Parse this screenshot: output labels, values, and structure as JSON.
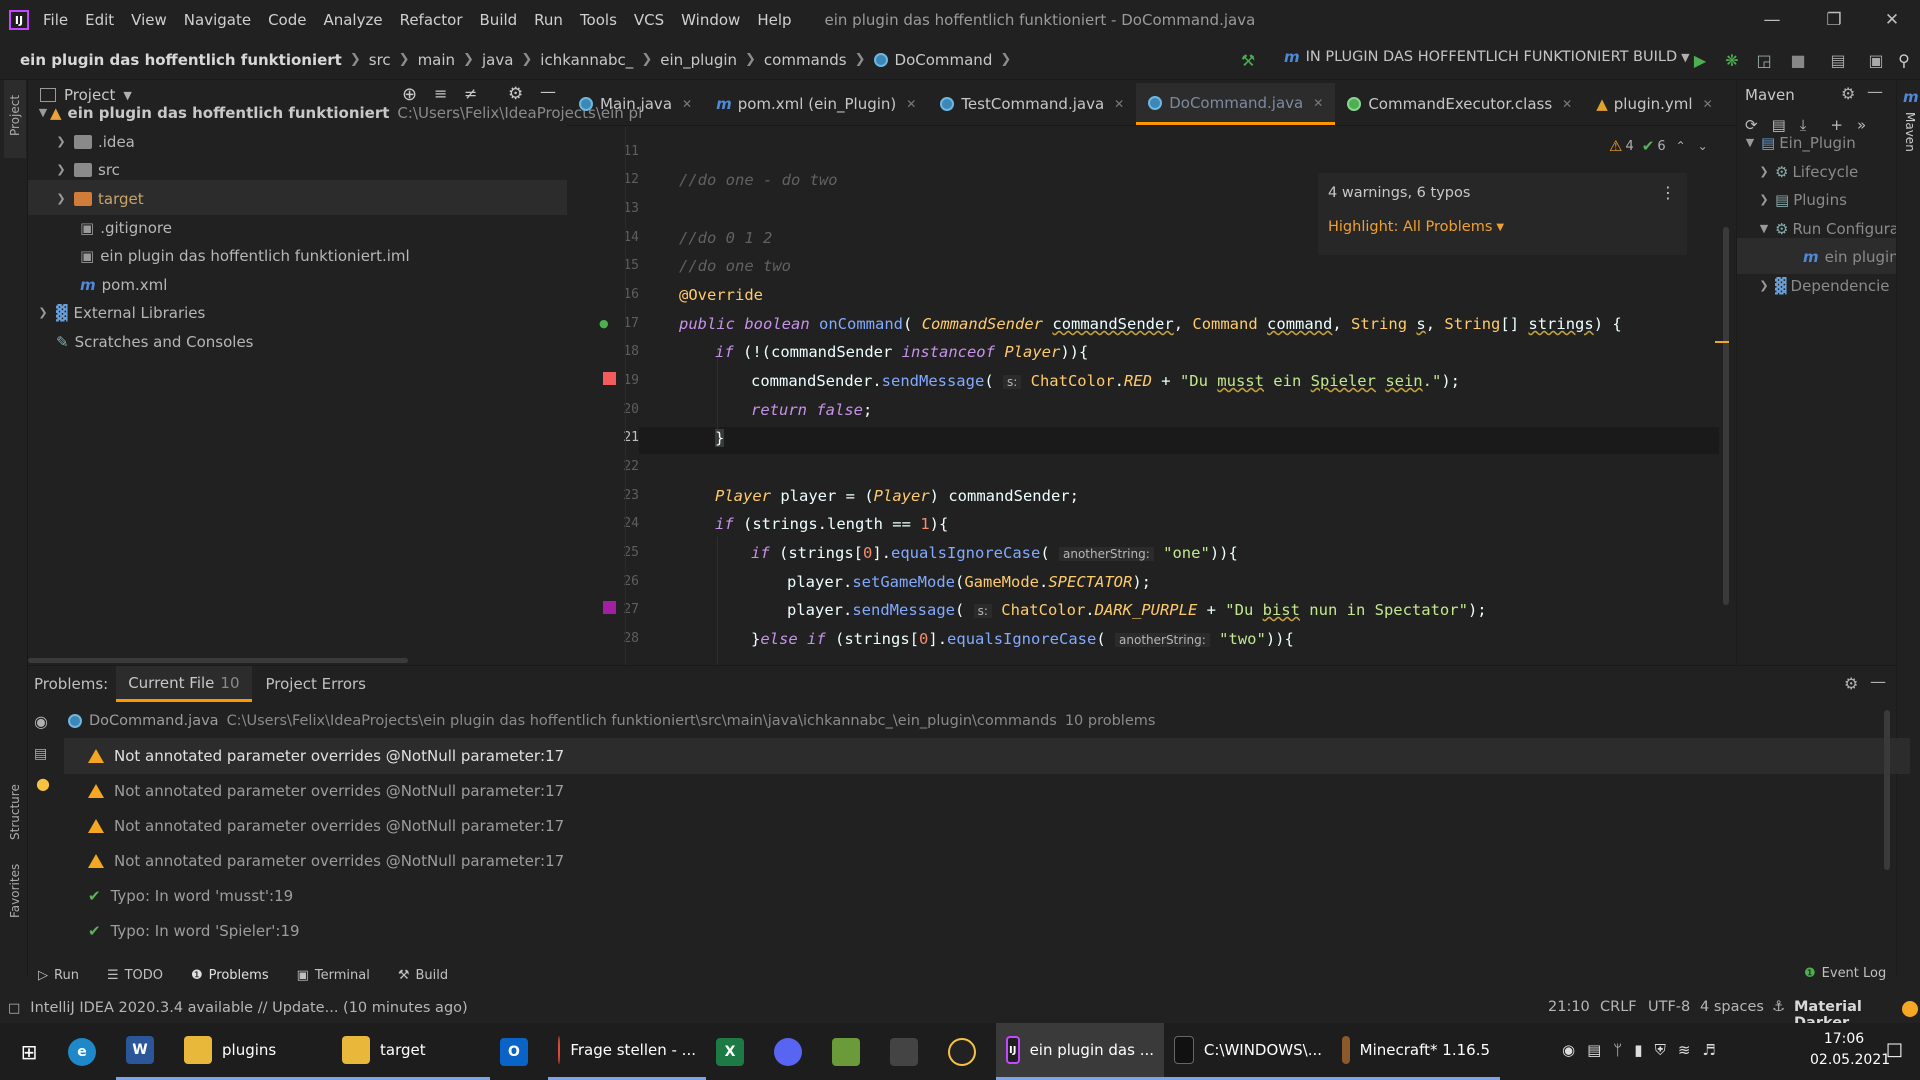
{
  "menubar": {
    "items": [
      "File",
      "Edit",
      "View",
      "Navigate",
      "Code",
      "Analyze",
      "Refactor",
      "Build",
      "Run",
      "Tools",
      "VCS",
      "Window",
      "Help"
    ],
    "window_title": "ein plugin das hoffentlich funktioniert - DoCommand.java"
  },
  "breadcrumbs": [
    "ein plugin das hoffentlich funktioniert",
    "src",
    "main",
    "java",
    "ichkannabc_",
    "ein_plugin",
    "commands",
    "DoCommand"
  ],
  "run_config": "IN PLUGIN DAS HOFFENTLICH FUNKTIONIERT BUILD",
  "project": {
    "title": "Project",
    "root": "ein plugin das hoffentlich funktioniert",
    "root_path": "C:\\Users\\Felix\\IdeaProjects\\ein pl",
    "items": [
      ".idea",
      "src",
      "target",
      ".gitignore",
      "ein plugin das hoffentlich funktioniert.iml",
      "pom.xml",
      "External Libraries",
      "Scratches and Consoles"
    ]
  },
  "tabs": [
    "Main.java",
    "pom.xml (ein_Plugin)",
    "TestCommand.java",
    "DoCommand.java",
    "CommandExecutor.class",
    "plugin.yml"
  ],
  "inspection": {
    "warnings": "4",
    "typos": "6",
    "summary": "4 warnings, 6 typos",
    "highlight": "Highlight: All Problems"
  },
  "editor": {
    "line_numbers": [
      "11",
      "12",
      "13",
      "14",
      "15",
      "16",
      "17",
      "18",
      "19",
      "20",
      "21",
      "22",
      "23",
      "24",
      "25",
      "26",
      "27",
      "28"
    ],
    "comment1": "//do one - do two",
    "comment2": "//do 0 1 2",
    "comment3": "//do one two",
    "hint_s": "s:",
    "hint_another": "anotherString:"
  },
  "maven": {
    "title": "Maven",
    "items": [
      "Ein_Plugin",
      "Lifecycle",
      "Plugins",
      "Run Configura",
      "ein plugin",
      "Dependencie"
    ]
  },
  "problems": {
    "label": "Problems:",
    "tab_current": "Current File",
    "tab_current_count": "10",
    "tab_project": "Project Errors",
    "file": "DoCommand.java",
    "file_path": "C:\\Users\\Felix\\IdeaProjects\\ein plugin das hoffentlich funktioniert\\src\\main\\java\\ichkannabc_\\ein_plugin\\commands",
    "count": "10 problems",
    "rows": [
      {
        "kind": "warn",
        "text": "Not annotated parameter overrides @NotNull parameter",
        "loc": ":17"
      },
      {
        "kind": "warn",
        "text": "Not annotated parameter overrides @NotNull parameter",
        "loc": ":17"
      },
      {
        "kind": "warn",
        "text": "Not annotated parameter overrides @NotNull parameter",
        "loc": ":17"
      },
      {
        "kind": "warn",
        "text": "Not annotated parameter overrides @NotNull parameter",
        "loc": ":17"
      },
      {
        "kind": "typo",
        "text": "Typo: In word 'musst'",
        "loc": ":19"
      },
      {
        "kind": "typo",
        "text": "Typo: In word 'Spieler'",
        "loc": ":19"
      }
    ]
  },
  "toolwindows": [
    "Run",
    "TODO",
    "Problems",
    "Terminal",
    "Build"
  ],
  "event_log": "Event Log",
  "status": {
    "message": "IntelliJ IDEA 2020.3.4 available // Update... (10 minutes ago)",
    "position": "21:10",
    "line_sep": "CRLF",
    "encoding": "UTF-8",
    "indent": "4 spaces",
    "theme": "Material Darker"
  },
  "side_labels": {
    "project": "Project",
    "structure": "Structure",
    "favorites": "Favorites",
    "maven": "Maven"
  },
  "taskbar": {
    "apps": [
      "plugins",
      "target",
      "Frage stellen - ...",
      "ein plugin das ...",
      "C:\\WINDOWS\\...",
      "Minecraft* 1.16.5"
    ],
    "time": "17:06",
    "date": "02.05.2021"
  }
}
